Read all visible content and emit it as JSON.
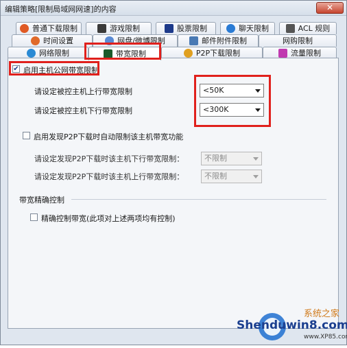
{
  "window": {
    "title": "编辑策略[限制局域网网速]的内容",
    "close_glyph": "✕"
  },
  "tabs": {
    "row1": [
      {
        "label": "普通下载限制",
        "icon": "clock-download-icon",
        "color": "#e05a24"
      },
      {
        "label": "游戏限制",
        "icon": "game-icon",
        "color": "#3a3a3a"
      },
      {
        "label": "股票限制",
        "icon": "stock-chart-icon",
        "color": "#1d3a8a"
      },
      {
        "label": "聊天限制",
        "icon": "chat-users-icon",
        "color": "#2a7bd4"
      },
      {
        "label": "ACL 规则",
        "icon": "acl-rule-icon",
        "color": "#555555"
      }
    ],
    "row2": [
      {
        "label": "时间设置",
        "icon": "clock-icon",
        "color": "#e06a2a"
      },
      {
        "label": "网盘/微博限制",
        "icon": "cloud-icon",
        "color": "#5a8ad4"
      },
      {
        "label": "邮件附件限制",
        "icon": "mail-attachment-icon",
        "color": "#4a7ab4"
      },
      {
        "label": "网购限制",
        "icon": "shopping-icon",
        "color": "#e04a2a"
      }
    ],
    "row3": [
      {
        "label": "网络限制",
        "icon": "network-globe-icon",
        "color": "#2a8ad4"
      },
      {
        "label": "带宽限制",
        "icon": "bandwidth-icon",
        "color": "#1a5a2a"
      },
      {
        "label": "P2P下载限制",
        "icon": "p2p-icon",
        "color": "#e0a020"
      },
      {
        "label": "流量限制",
        "icon": "traffic-bars-icon",
        "color": "#c03ab0"
      }
    ]
  },
  "bandwidth": {
    "enable_host_label": "启用主机公网带宽限制",
    "enable_host_checked": true,
    "upload_label": "请设定被控主机上行带宽限制",
    "upload_value": "<50K",
    "download_label": "请设定被控主机下行带宽限制",
    "download_value": "<300K",
    "p2p_auto_label": "启用发现P2P下载时自动限制该主机带宽功能",
    "p2p_auto_checked": false,
    "p2p_download_label": "请设定发现P2P下载时该主机下行带宽限制：",
    "p2p_download_value": "不限制",
    "p2p_upload_label": "请设定发现P2P下载时该主机上行带宽限制：",
    "p2p_upload_value": "不限制",
    "precise_group_label": "带宽精确控制",
    "precise_label": "精确控制带宽(此项对上述两项均有控制)",
    "precise_checked": false
  },
  "watermark": {
    "brand": "Shenduwin8.com",
    "sub": "系统之家",
    "url": "www.XP85.com"
  },
  "colors": {
    "highlight_red": "#e0201c",
    "window_bg": "#dfe6ef",
    "panel_bg": "#f4f6f9"
  }
}
